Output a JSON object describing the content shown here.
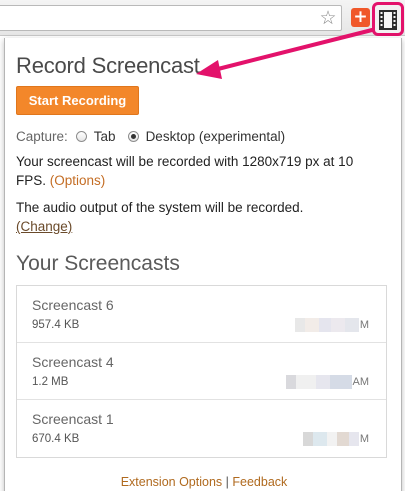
{
  "toolbar": {
    "star_icon": "star-outline-icon",
    "plus_label": "+",
    "film_icon": "film-strip-icon"
  },
  "popup": {
    "title": "Record Screencast",
    "start_button": "Start Recording",
    "capture": {
      "label": "Capture:",
      "options": [
        {
          "label": "Tab",
          "selected": false
        },
        {
          "label": "Desktop (experimental)",
          "selected": true
        }
      ]
    },
    "resolution_text": "Your screencast will be recorded with 1280x719 px at 10 FPS.",
    "options_link": "(Options)",
    "audio_text": "The audio output of the system will be recorded.",
    "change_link": "(Change)",
    "screencasts_title": "Your Screencasts",
    "screencasts": [
      {
        "name": "Screencast 6",
        "size": "957.4 KB",
        "time_suffix": "M"
      },
      {
        "name": "Screencast 4",
        "size": "1.2 MB",
        "time_suffix": "AM"
      },
      {
        "name": "Screencast 1",
        "size": "670.4 KB",
        "time_suffix": "M"
      }
    ],
    "footer": {
      "extension_options": "Extension Options",
      "separator": " | ",
      "feedback": "Feedback"
    }
  },
  "colors": {
    "accent_orange": "#f3872a",
    "link_orange": "#c46d24",
    "highlight_pink": "#e3126b",
    "addon_orange": "#f0582a"
  }
}
